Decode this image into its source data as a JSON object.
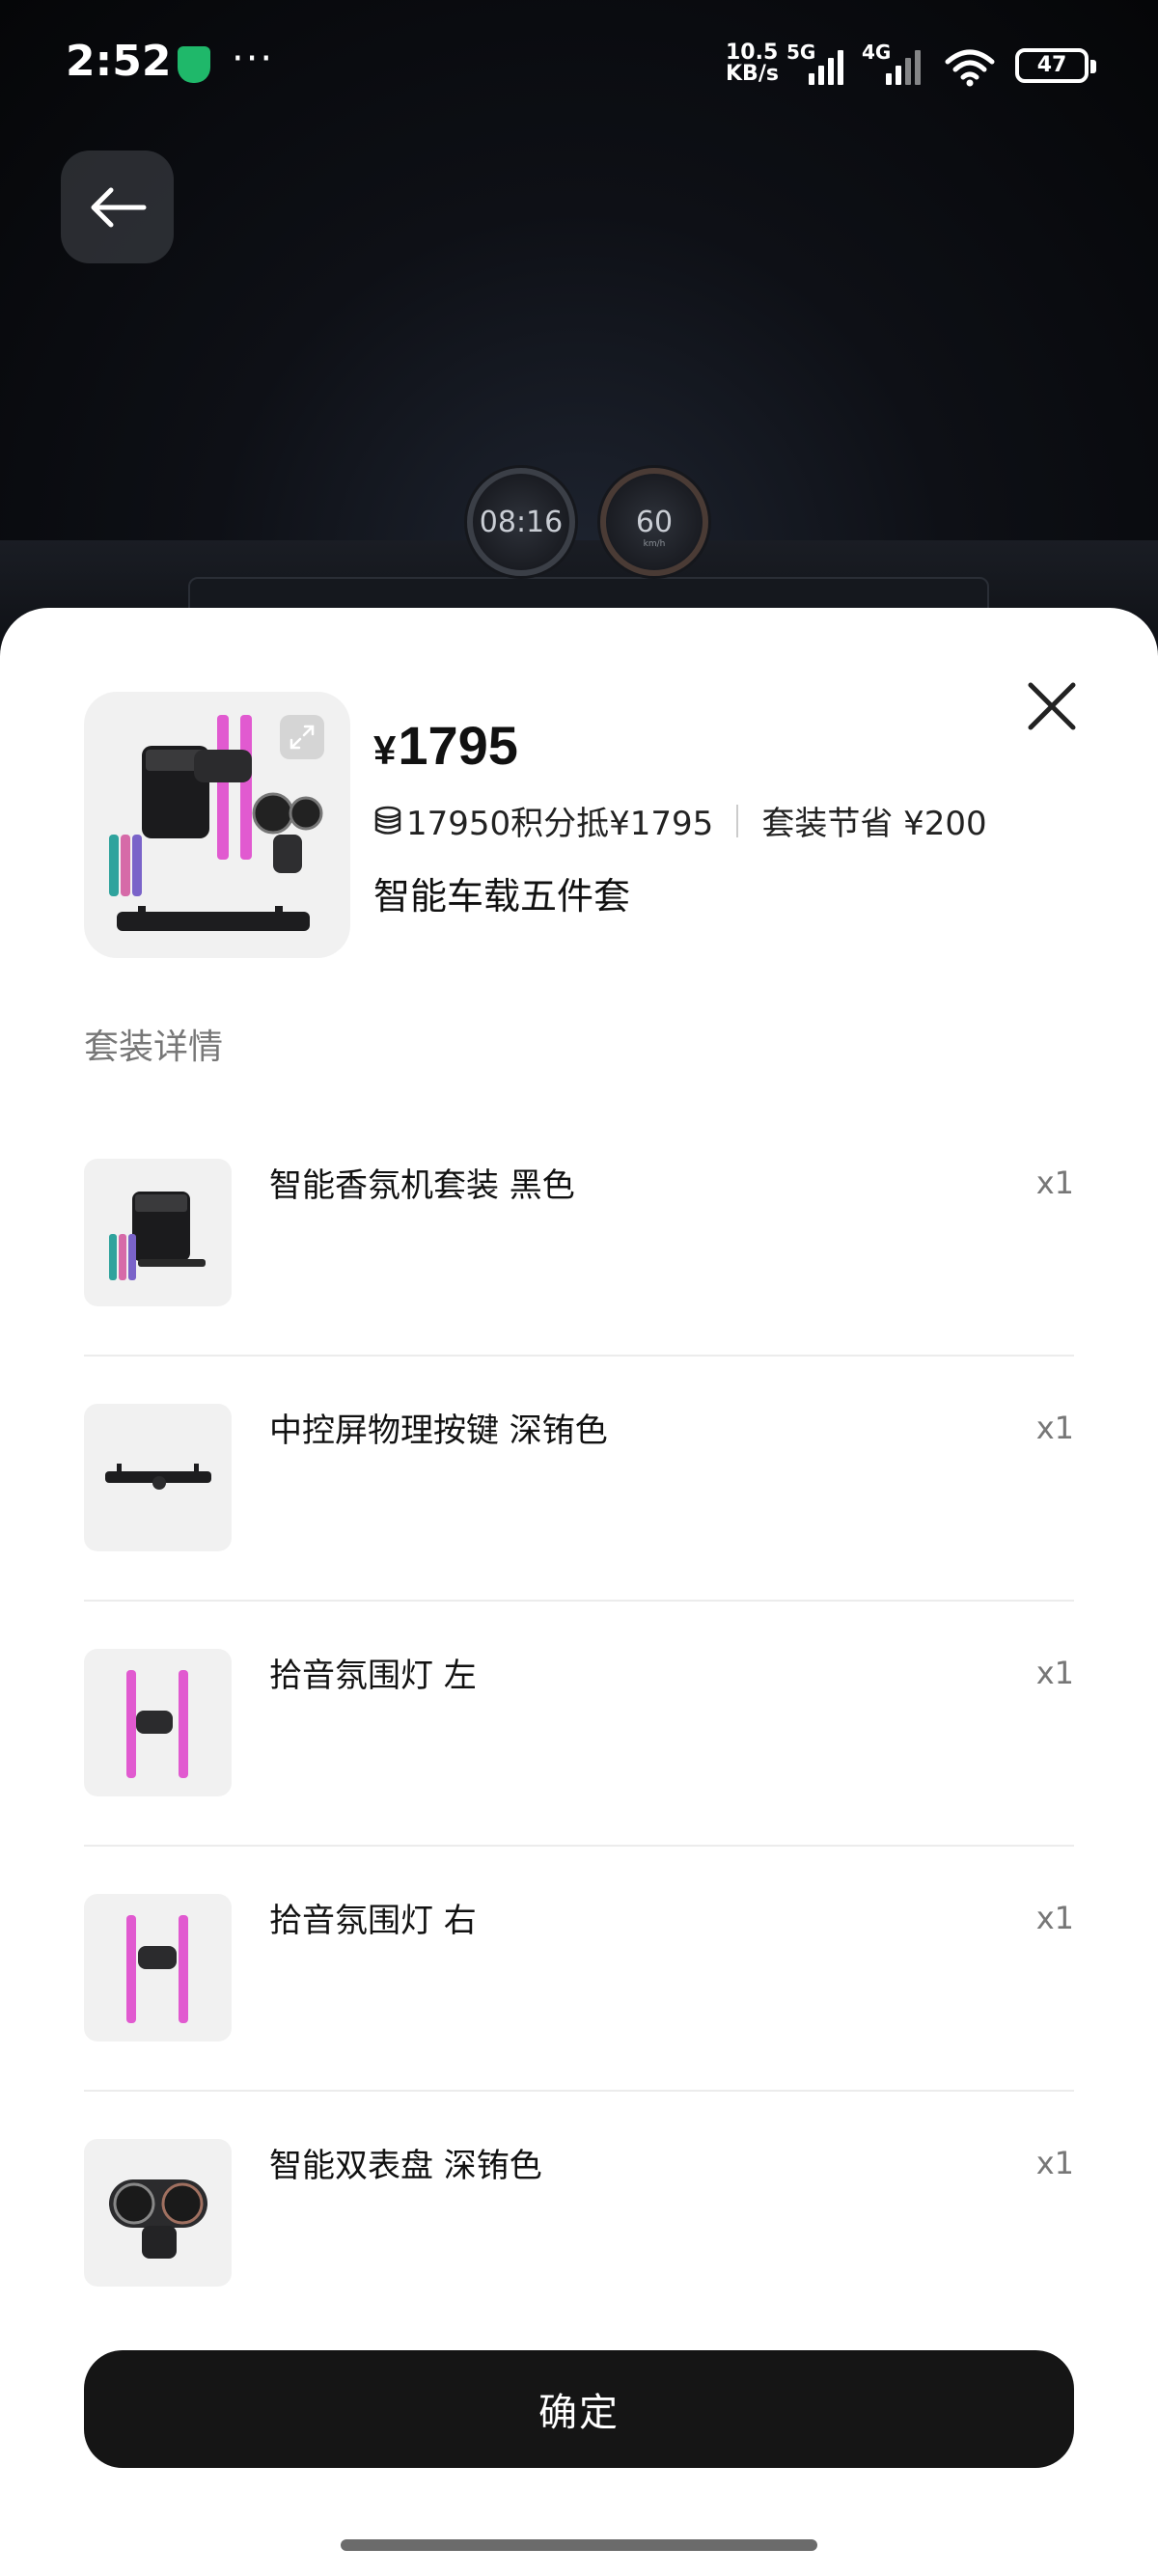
{
  "status_bar": {
    "time": "2:52",
    "dots": "···",
    "net_speed_value": "10.5",
    "net_speed_unit": "KB/s",
    "net_5g": "5G",
    "net_4g": "4G",
    "battery": "47"
  },
  "sheet": {
    "price_symbol": "¥",
    "price": "1795",
    "points_text": "17950积分抵¥1795",
    "bundle_save_text": "套装节省 ¥200",
    "product_title": "智能车载五件套",
    "section_title": "套装详情",
    "items": [
      {
        "name": "智能香氛机套装 黑色",
        "qty": "x1"
      },
      {
        "name": "中控屏物理按键 深铕色",
        "qty": "x1"
      },
      {
        "name": "拾音氛围灯 左",
        "qty": "x1"
      },
      {
        "name": "拾音氛围灯 右",
        "qty": "x1"
      },
      {
        "name": "智能双表盘 深铕色",
        "qty": "x1"
      }
    ],
    "confirm_label": "确定"
  },
  "hero": {
    "gauge_left": "08:16",
    "gauge_right": "60"
  },
  "colors": {
    "confirm_bg": "#151515",
    "app_badge": "#1fb86a",
    "ambient_pink": "#e15ad0"
  }
}
